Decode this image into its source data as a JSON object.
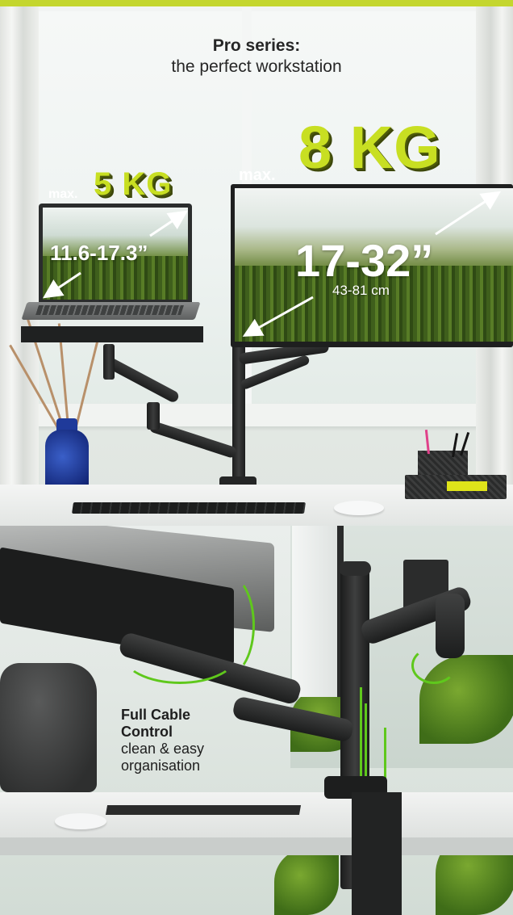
{
  "headline": {
    "title": "Pro series:",
    "subtitle": "the perfect workstation"
  },
  "laptop_load": {
    "max_label": "max.",
    "weight": "5 KG",
    "size": "11.6-17.3”"
  },
  "monitor_load": {
    "max_label": "max.",
    "weight": "8 KG",
    "size": "17-32”",
    "size_cm": "43-81 cm"
  },
  "cable_feature": {
    "title_line1": "Full Cable",
    "title_line2": "Control",
    "desc_line1": "clean & easy",
    "desc_line2": "organisation"
  },
  "colors": {
    "accent": "#c4d62e",
    "kg_green": "#c8df22",
    "cable_green": "#5fc81c",
    "stand": "#1e1f1f"
  }
}
